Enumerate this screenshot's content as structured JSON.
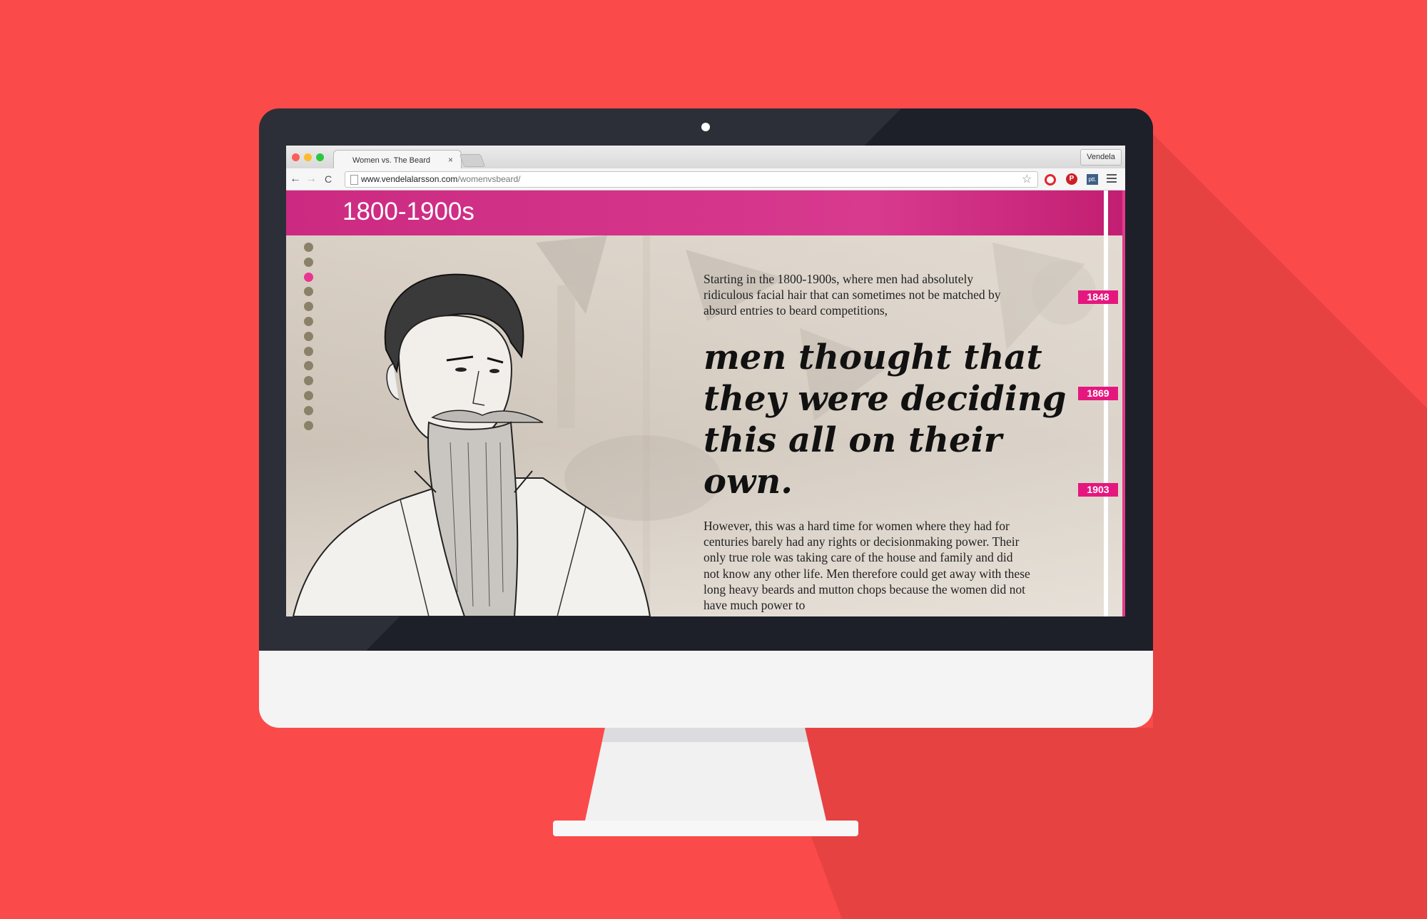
{
  "browser": {
    "tab_title": "Women vs. The Beard",
    "tab_close": "×",
    "profile": "Vendela",
    "back": "←",
    "forward": "→",
    "reload": "C",
    "url_domain": "www.vendelalarsson.com",
    "url_path": "/womenvsbeard/",
    "star": "☆",
    "ext_pinterest": "P",
    "ext_ptt": "ptt."
  },
  "page": {
    "heading": "1800-1900s",
    "intro": "Starting in the 1800-1900s, where men had absolutely ridiculous facial hair that can sometimes not be matched by absurd entries to beard competitions,",
    "quote": "men thought that they were deciding this all on their own.",
    "body": "However, this was a hard time for women where they had for centuries barely had any rights or decisionmaking power. Their only true role was taking care of the house and family and did not know any other life. Men therefore could get away with these long heavy beards and mutton chops because the women did not have much power to",
    "timeline": [
      "1848",
      "1869",
      "1903"
    ],
    "dot_nav": {
      "count": 13,
      "active_index": 2
    }
  },
  "colors": {
    "background": "#fb4a4a",
    "accent": "#e5177f",
    "header": "#cc2a82",
    "bezel": "#2c2f37"
  }
}
